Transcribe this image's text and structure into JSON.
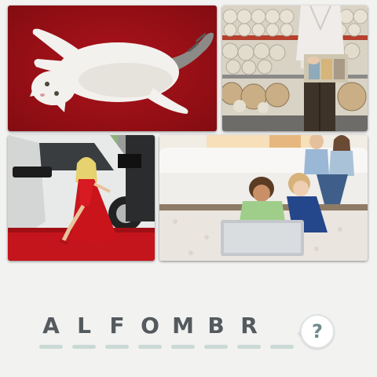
{
  "puzzle": {
    "images": [
      {
        "name": "cat-on-red-carpet"
      },
      {
        "name": "carpet-rolls-store"
      },
      {
        "name": "red-carpet-arrival"
      },
      {
        "name": "children-on-rug"
      }
    ],
    "answer_slots": [
      {
        "letter": "A"
      },
      {
        "letter": "L"
      },
      {
        "letter": "F"
      },
      {
        "letter": "O"
      },
      {
        "letter": "M"
      },
      {
        "letter": "B"
      },
      {
        "letter": "R"
      },
      {
        "letter": ""
      }
    ],
    "hint_symbol": "?"
  },
  "colors": {
    "background": "#f2f2f1",
    "letter": "#545a5e",
    "slot_dash": "#c9d9d5",
    "hint_icon": "#6f8a8c"
  }
}
